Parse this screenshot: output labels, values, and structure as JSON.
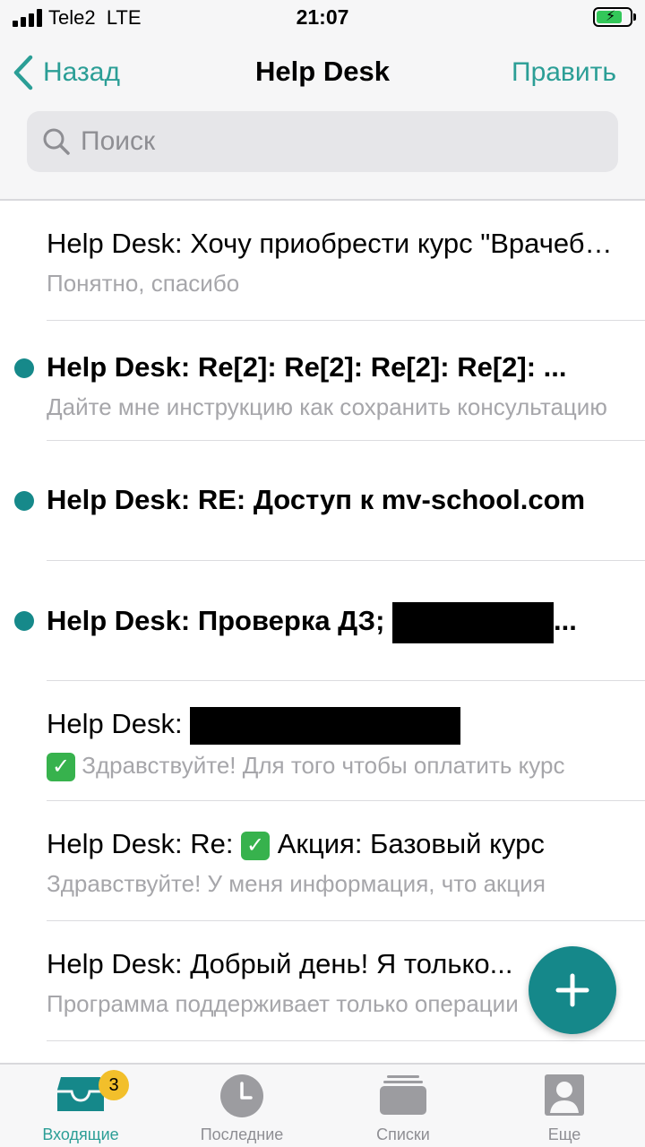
{
  "status_bar": {
    "carrier": "Tele2",
    "network": "LTE",
    "time": "21:07"
  },
  "nav": {
    "back_label": "Назад",
    "title": "Help Desk",
    "edit_label": "Править"
  },
  "search": {
    "placeholder": "Поиск"
  },
  "messages": [
    {
      "subject": "Help Desk: Хочу приобрести курс \"Врачебная...",
      "preview": "Понятно, спасибо",
      "unread": false
    },
    {
      "subject": "Help Desk: Re[2]: Re[2]: Re[2]: Re[2]: ...",
      "preview": "Дайте мне инструкцию как сохранить консультацию",
      "unread": true
    },
    {
      "subject": "Help Desk: RE: Доступ к mv-school.com",
      "preview": "",
      "unread": true
    },
    {
      "subject_prefix": "Help Desk: Проверка ДЗ;",
      "subject_suffix": "...",
      "preview": "",
      "unread": true,
      "redacted": true
    },
    {
      "subject_prefix": "Help Desk:",
      "preview_check": "✓",
      "preview": "Здравствуйте! Для того чтобы оплатить курс",
      "unread": false,
      "redacted": true
    },
    {
      "subject_prefix": "Help Desk: Re:",
      "subject_check": "✓",
      "subject_suffix": "Акция: Базовый курс",
      "preview": "Здравствуйте! У меня информация, что акция",
      "unread": false
    },
    {
      "subject": "Help Desk: Добрый день! Я только...",
      "preview": "Программа поддерживает только операции",
      "unread": false
    }
  ],
  "fab": {
    "icon": "plus-icon"
  },
  "tabs": [
    {
      "label": "Входящие",
      "badge": "3",
      "active": true,
      "icon": "inbox-icon"
    },
    {
      "label": "Последние",
      "active": false,
      "icon": "clock-icon"
    },
    {
      "label": "Списки",
      "active": false,
      "icon": "stack-icon"
    },
    {
      "label": "Еще",
      "active": false,
      "icon": "person-icon"
    }
  ],
  "colors": {
    "accent": "#2b9e96",
    "unread_dot": "#16898a",
    "fab": "#15888a",
    "badge": "#f2bf2b"
  }
}
